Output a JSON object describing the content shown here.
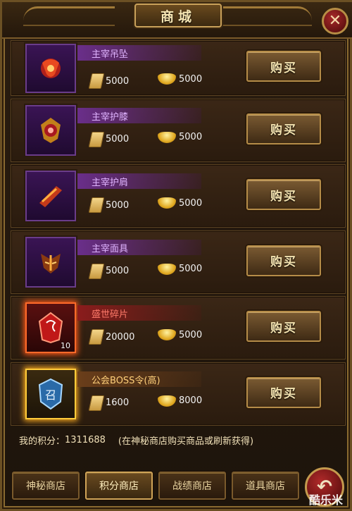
{
  "header": {
    "title": "商城",
    "close_icon": "close-icon"
  },
  "items": [
    {
      "name": "主宰吊坠",
      "points_price": "5000",
      "gold_price": "5000",
      "buy_label": "购买",
      "style": "purple",
      "icon": "pendant-icon"
    },
    {
      "name": "主宰护膝",
      "points_price": "5000",
      "gold_price": "5000",
      "buy_label": "购买",
      "style": "purple",
      "icon": "kneepad-icon"
    },
    {
      "name": "主宰护肩",
      "points_price": "5000",
      "gold_price": "5000",
      "buy_label": "购买",
      "style": "purple",
      "icon": "shoulder-icon"
    },
    {
      "name": "主宰面具",
      "points_price": "5000",
      "gold_price": "5000",
      "buy_label": "购买",
      "style": "purple",
      "icon": "mask-icon"
    },
    {
      "name": "盛世碎片",
      "points_price": "20000",
      "gold_price": "5000",
      "buy_label": "购买",
      "style": "red",
      "icon": "fragment-icon",
      "count": "10"
    },
    {
      "name": "公会BOSS令(高)",
      "points_price": "1600",
      "gold_price": "8000",
      "buy_label": "购买",
      "style": "gold",
      "icon": "boss-token-icon"
    }
  ],
  "points": {
    "label": "我的积分：",
    "value": "1311688",
    "hint": "(在神秘商店购买商品或刷新获得)"
  },
  "tabs": [
    "神秘商店",
    "积分商店",
    "战绩商店",
    "道具商店"
  ],
  "active_tab": "积分商店",
  "back_icon": "back-arrow-icon",
  "watermark": "酷乐米"
}
